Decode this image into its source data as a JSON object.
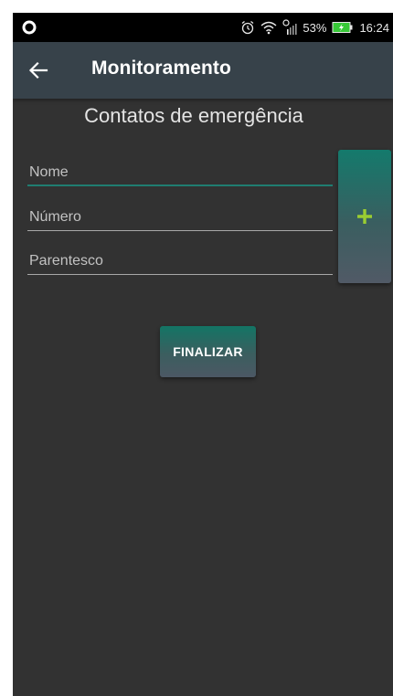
{
  "status_bar": {
    "battery": "53%",
    "time": "16:24",
    "icons": [
      "circle-indicator-icon",
      "alarm-icon",
      "wifi-icon",
      "signal-icon",
      "battery-icon"
    ]
  },
  "app_bar": {
    "title": "Monitoramento",
    "back_icon": "arrow-left-icon"
  },
  "content": {
    "section_title": "Contatos de emergência",
    "fields": {
      "name_placeholder": "Nome",
      "number_placeholder": "Número",
      "relationship_placeholder": "Parentesco"
    },
    "add_icon": "plus-icon",
    "finish_label": "FINALIZAR"
  },
  "colors": {
    "background": "#323232",
    "app_bar": "#37424a",
    "accent": "#1f7d71",
    "plus": "#9acd32"
  }
}
